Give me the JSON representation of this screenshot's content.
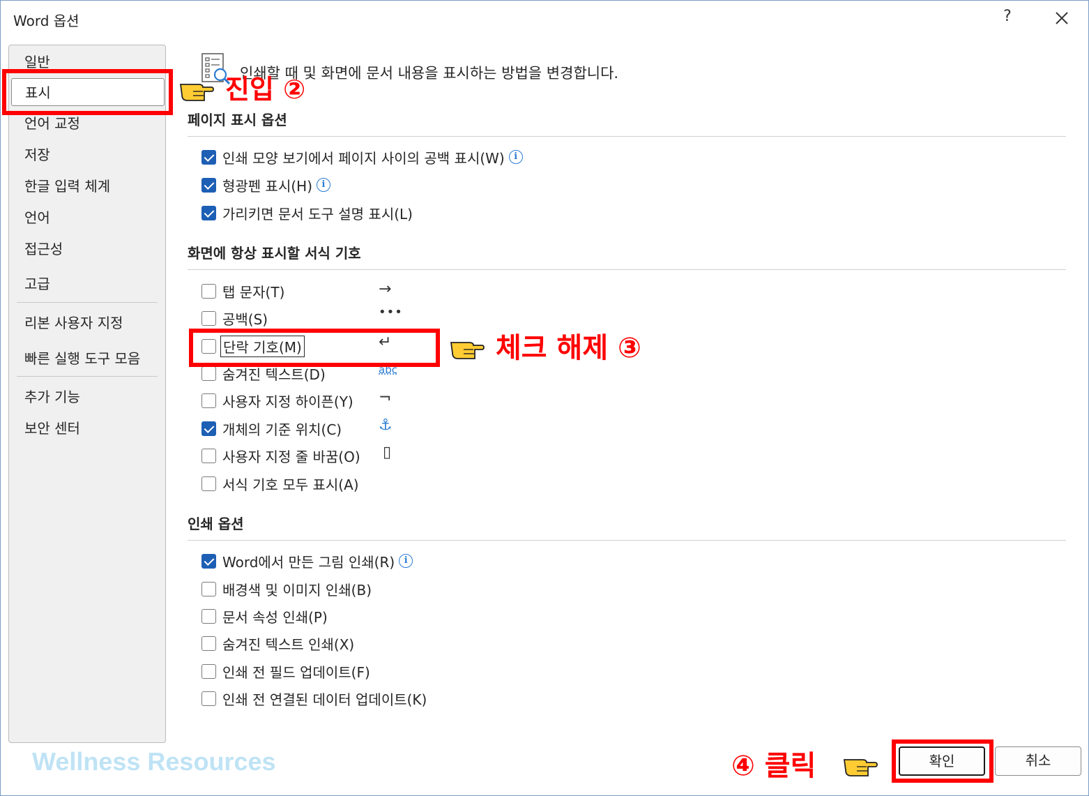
{
  "window": {
    "title": "Word 옵션",
    "help_label": "?",
    "close_icon": "close-icon"
  },
  "sidebar": {
    "items": [
      {
        "label": "일반"
      },
      {
        "label": "표시",
        "selected": true
      },
      {
        "label": "언어 교정"
      },
      {
        "label": "저장"
      },
      {
        "label": "한글 입력 체계"
      },
      {
        "label": "언어"
      },
      {
        "label": "접근성"
      },
      {
        "label": "고급"
      },
      {
        "label": "리본 사용자 지정"
      },
      {
        "label": "빠른 실행 도구 모음"
      },
      {
        "label": "추가 기능"
      },
      {
        "label": "보안 센터"
      }
    ]
  },
  "main": {
    "header": "인쇄할 때 및 화면에 문서 내용을 표시하는 방법을 변경합니다.",
    "header_icon": "display-options-icon",
    "page_display": {
      "title": "페이지 표시 옵션",
      "options": [
        {
          "label": "인쇄 모양 보기에서 페이지 사이의 공백 표시(W)",
          "checked": true,
          "info": true
        },
        {
          "label": "형광펜 표시(H)",
          "checked": true,
          "info": true
        },
        {
          "label": "가리키면 문서 도구 설명 표시(L)",
          "checked": true
        }
      ]
    },
    "formatting_marks": {
      "title": "화면에 항상 표시할 서식 기호",
      "options": [
        {
          "label": "탭 문자(T)",
          "checked": false,
          "symbol": "→"
        },
        {
          "label": "공백(S)",
          "checked": false,
          "symbol": "•••"
        },
        {
          "label": "단락 기호(M)",
          "checked": false,
          "symbol": "↵"
        },
        {
          "label": "숨겨진 텍스트(D)",
          "checked": false,
          "symbol": "abc"
        },
        {
          "label": "사용자 지정 하이픈(Y)",
          "checked": false,
          "symbol": "¬"
        },
        {
          "label": "개체의 기준 위치(C)",
          "checked": true,
          "symbol": "⚓"
        },
        {
          "label": "사용자 지정 줄 바꿈(O)",
          "checked": false,
          "symbol": "▯"
        },
        {
          "label": "서식 기호 모두 표시(A)",
          "checked": false
        }
      ]
    },
    "print_options": {
      "title": "인쇄 옵션",
      "options": [
        {
          "label": "Word에서 만든 그림 인쇄(R)",
          "checked": true,
          "info": true
        },
        {
          "label": "배경색 및 이미지 인쇄(B)",
          "checked": false
        },
        {
          "label": "문서 속성 인쇄(P)",
          "checked": false
        },
        {
          "label": "숨겨진 텍스트 인쇄(X)",
          "checked": false
        },
        {
          "label": "인쇄 전 필드 업데이트(F)",
          "checked": false
        },
        {
          "label": "인쇄 전 연결된 데이터 업데이트(K)",
          "checked": false
        }
      ]
    }
  },
  "footer": {
    "ok_label": "확인",
    "cancel_label": "취소",
    "watermark": "Wellness Resources"
  },
  "annotations": {
    "step2": "진입 ②",
    "step3": "체크 해제 ③",
    "step4": "④ 클릭",
    "highlight_color": "#ff0000"
  },
  "colors": {
    "checkbox_checked": "#1d5fb4",
    "info_icon": "#2b7cd3",
    "sidebar_bg": "#f0f0f0",
    "watermark": "#bfe3f5"
  }
}
